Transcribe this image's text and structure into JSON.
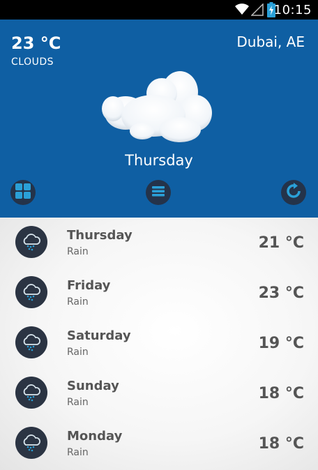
{
  "status_bar": {
    "time": "10:15"
  },
  "current": {
    "temperature": "23 °C",
    "condition": "CLOUDS",
    "location": "Dubai, AE",
    "day": "Thursday",
    "weather_icon": "cloud-icon"
  },
  "actions": [
    {
      "name": "grid-icon"
    },
    {
      "name": "menu-icon"
    },
    {
      "name": "refresh-icon"
    }
  ],
  "forecast": [
    {
      "day": "Thursday",
      "desc": "Rain",
      "temp": "21 °C",
      "icon": "rain-cloud-icon"
    },
    {
      "day": "Friday",
      "desc": "Rain",
      "temp": "23 °C",
      "icon": "rain-cloud-icon"
    },
    {
      "day": "Saturday",
      "desc": "Rain",
      "temp": "19 °C",
      "icon": "rain-cloud-icon"
    },
    {
      "day": "Sunday",
      "desc": "Rain",
      "temp": "18 °C",
      "icon": "rain-cloud-icon"
    },
    {
      "day": "Monday",
      "desc": "Rain",
      "temp": "18 °C",
      "icon": "rain-cloud-icon"
    }
  ],
  "colors": {
    "header": "#0f5fa3",
    "accent": "#2aa0d8",
    "dark": "#24334a"
  }
}
